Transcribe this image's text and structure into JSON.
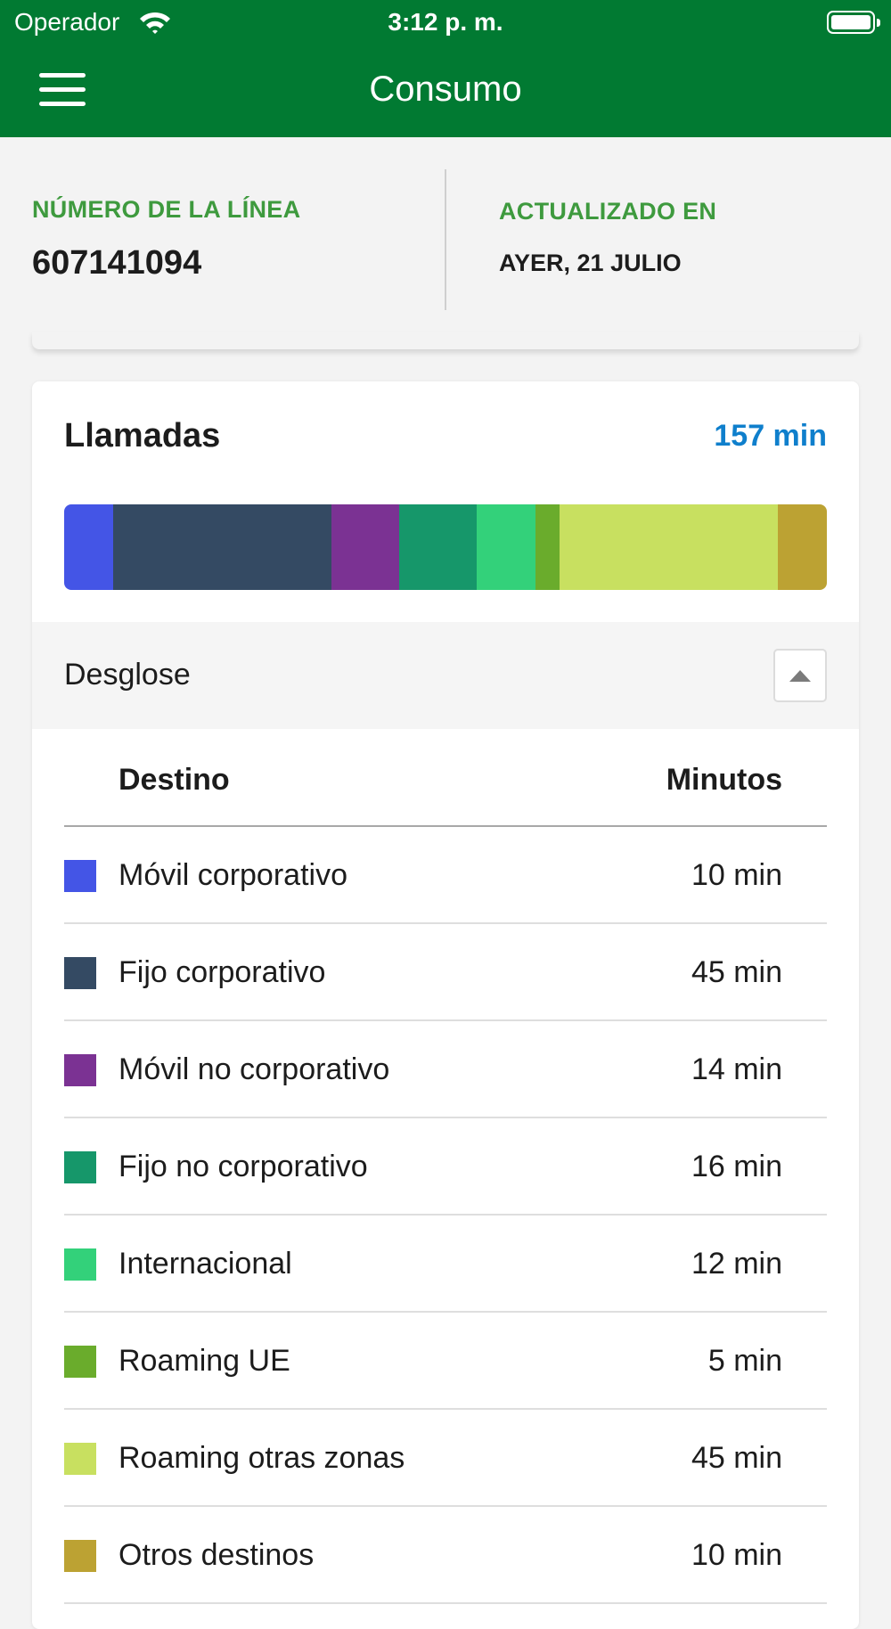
{
  "status_bar": {
    "carrier": "Operador",
    "time": "3:12 p. m.",
    "icons": [
      "wifi-icon",
      "battery-icon"
    ]
  },
  "nav": {
    "title": "Consumo",
    "menu_icon": "hamburger-menu-icon"
  },
  "line_info": {
    "number_label": "NÚMERO DE LA LÍNEA",
    "number_value": "607141094",
    "updated_label": "ACTUALIZADO EN",
    "updated_value": "AYER, 21 JULIO"
  },
  "calls": {
    "title": "Llamadas",
    "total": "157 min",
    "breakdown_label": "Desglose",
    "collapse_icon": "caret-up-icon",
    "table": {
      "col_destination": "Destino",
      "col_minutes": "Minutos",
      "rows": [
        {
          "label": "Móvil corporativo",
          "value": "10 min",
          "minutes": 10,
          "color": "#4455e6"
        },
        {
          "label": "Fijo corporativo",
          "value": "45 min",
          "minutes": 45,
          "color": "#344a63"
        },
        {
          "label": "Móvil no corporativo",
          "value": "14 min",
          "minutes": 14,
          "color": "#7b3293"
        },
        {
          "label": "Fijo no corporativo",
          "value": "16 min",
          "minutes": 16,
          "color": "#16976a"
        },
        {
          "label": "Internacional",
          "value": "12 min",
          "minutes": 12,
          "color": "#33d17a"
        },
        {
          "label": "Roaming UE",
          "value": "5 min",
          "minutes": 5,
          "color": "#6aac2c"
        },
        {
          "label": "Roaming otras zonas",
          "value": "45 min",
          "minutes": 45,
          "color": "#c8e060"
        },
        {
          "label": "Otros destinos",
          "value": "10 min",
          "minutes": 10,
          "color": "#bca233"
        }
      ]
    }
  },
  "colors": {
    "brand_green": "#017a32",
    "label_green": "#3e9a3e",
    "accent_blue": "#0f7fcc"
  }
}
